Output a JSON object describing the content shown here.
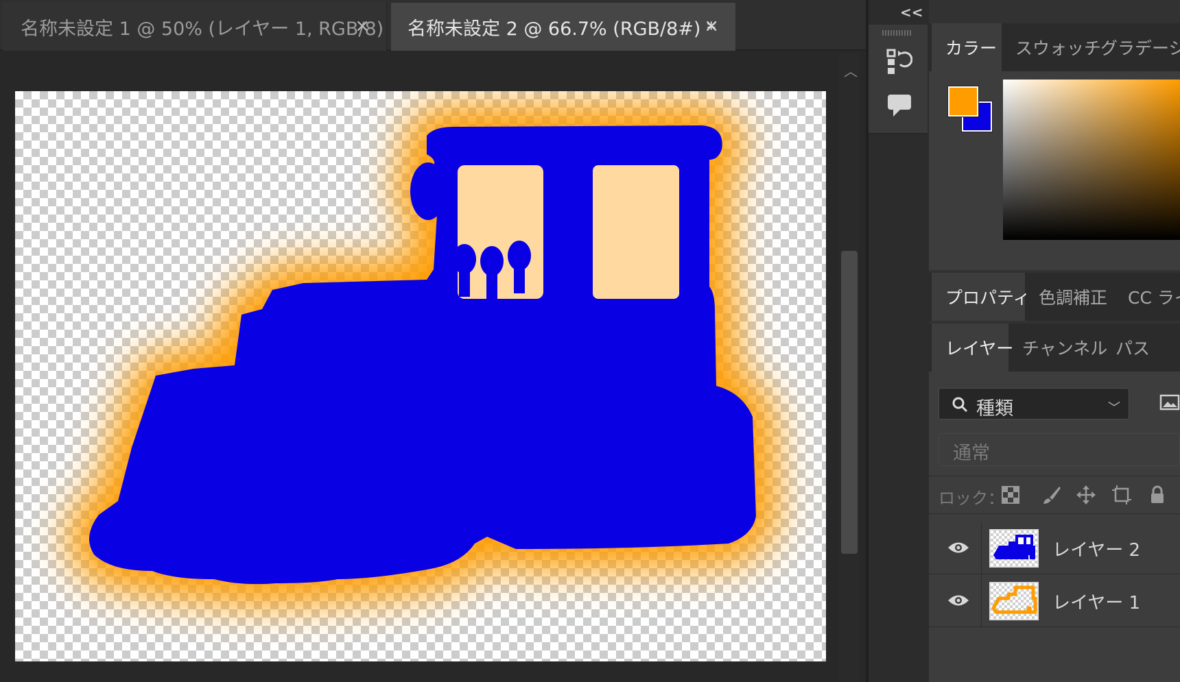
{
  "document_tabs": [
    {
      "label": "名称未設定 1 @ 50% (レイヤー 1, RGB/8)",
      "close": "×",
      "active": false
    },
    {
      "label": "名称未設定 2 @ 66.7% (RGB/8#) *",
      "close": "×",
      "active": true
    }
  ],
  "canvas": {
    "shape_icon": "bulldozer-silhouette",
    "fill_color": "#0a00e4",
    "glow_color": "#ff9c00"
  },
  "toolstrip": {
    "collapse": "<<",
    "icons": [
      "history-icon",
      "comment-icon"
    ]
  },
  "color_panel": {
    "tabs": [
      "カラー",
      "スウォッチ",
      "グラデーショ"
    ],
    "foreground_color": "#ff9c00",
    "background_color": "#0a00e4"
  },
  "properties_panel": {
    "tabs": [
      "プロパティ",
      "色調補正",
      "CC ライ"
    ]
  },
  "layers_panel": {
    "tabs": [
      "レイヤー",
      "チャンネル",
      "パス"
    ],
    "filter": {
      "value": "種類",
      "icon": "search-icon"
    },
    "blend_mode": "通常",
    "lock_label": "ロック：",
    "lock_icons": [
      "lock-transparency-icon",
      "lock-paint-icon",
      "lock-position-icon",
      "lock-artboard-icon",
      "lock-all-icon"
    ],
    "layers": [
      {
        "name": "レイヤー 2",
        "visible": true,
        "thumb": "blue-bulldozer"
      },
      {
        "name": "レイヤー 1",
        "visible": true,
        "thumb": "orange-outline"
      }
    ]
  }
}
